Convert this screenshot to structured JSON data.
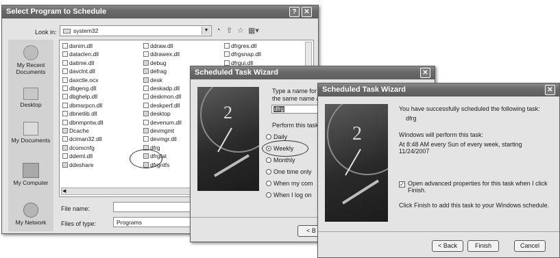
{
  "open_dialog": {
    "title": "Select Program to Schedule",
    "look_in_label": "Look in:",
    "look_in_value": "system32",
    "places": [
      "My Recent Documents",
      "Desktop",
      "My Documents",
      "My Computer",
      "My Network"
    ],
    "files_col1": [
      "danim.dll",
      "dataclen.dll",
      "datime.dll",
      "davclnt.dll",
      "daxctle.ocx",
      "dbgeng.dll",
      "dbghelp.dll",
      "dbmsrpcn.dll",
      "dbnetlib.dll",
      "dbnmpntw.dll",
      "Dcache",
      "dciman32.dll",
      "dcomcnfg",
      "ddeml.dll",
      "ddeshare"
    ],
    "files_col2": [
      "ddraw.dll",
      "ddrawex.dll",
      "debug",
      "defrag",
      "desk",
      "deskadp.dll",
      "deskmon.dll",
      "deskperf.dll",
      "desktop",
      "devenum.dll",
      "devmgmt",
      "devmgr.dll",
      "dfrg",
      "dfrgfat",
      "dfrgntfs"
    ],
    "files_col3": [
      "dfrgres.dll",
      "dfrgsnap.dll",
      "dfrgui.dll"
    ],
    "file_name_label": "File name:",
    "file_name_value": "",
    "files_of_type_label": "Files of type:",
    "files_of_type_value": "Programs"
  },
  "wizard1": {
    "title": "Scheduled Task Wizard",
    "prompt_line1": "Type a name for",
    "prompt_line2": "the same name a",
    "name_value": "dfrg",
    "perform_label": "Perform this task:",
    "options": [
      "Daily",
      "Weekly",
      "Monthly",
      "One time only",
      "When my com",
      "When I log on"
    ],
    "selected_option": "Weekly",
    "back_button": "< B"
  },
  "wizard2": {
    "title": "Scheduled Task Wizard",
    "success_text": "You have successfully scheduled the following task:",
    "task_name": "dfrg",
    "will_perform": "Windows will perform this task:",
    "schedule_line1": "At 8:48 AM every Sun of every week, starting",
    "schedule_line2": "11/24/2007",
    "checkbox_line1": "Open advanced properties for this task when I click",
    "checkbox_line2": "Finish.",
    "checkbox_checked": true,
    "finish_hint": "Click Finish to add this task to your Windows schedule.",
    "back_button": "< Back",
    "finish_button": "Finish",
    "cancel_button": "Cancel"
  }
}
